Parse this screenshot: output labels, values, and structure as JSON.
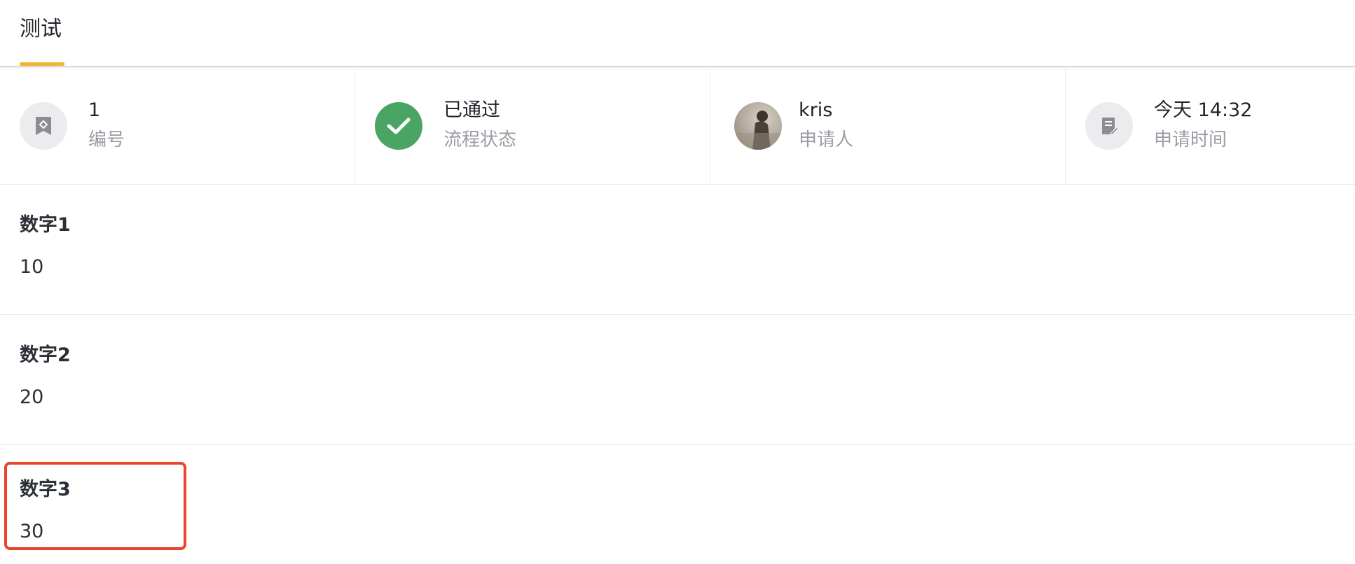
{
  "tab": {
    "label": "测试",
    "indicator_color": "#f2b632"
  },
  "info": {
    "number": {
      "value": "1",
      "label": "编号",
      "icon": "bookmark-icon"
    },
    "status": {
      "value": "已通过",
      "label": "流程状态",
      "icon": "check-circle-icon",
      "color": "#4aa564"
    },
    "applicant": {
      "value": "kris",
      "label": "申请人",
      "icon": "avatar"
    },
    "time": {
      "value": "今天 14:32",
      "label": "申请时间",
      "icon": "document-edit-icon"
    }
  },
  "fields": [
    {
      "label": "数字1",
      "value": "10"
    },
    {
      "label": "数字2",
      "value": "20"
    },
    {
      "label": "数字3",
      "value": "30"
    }
  ],
  "highlight_color": "#e8452c"
}
